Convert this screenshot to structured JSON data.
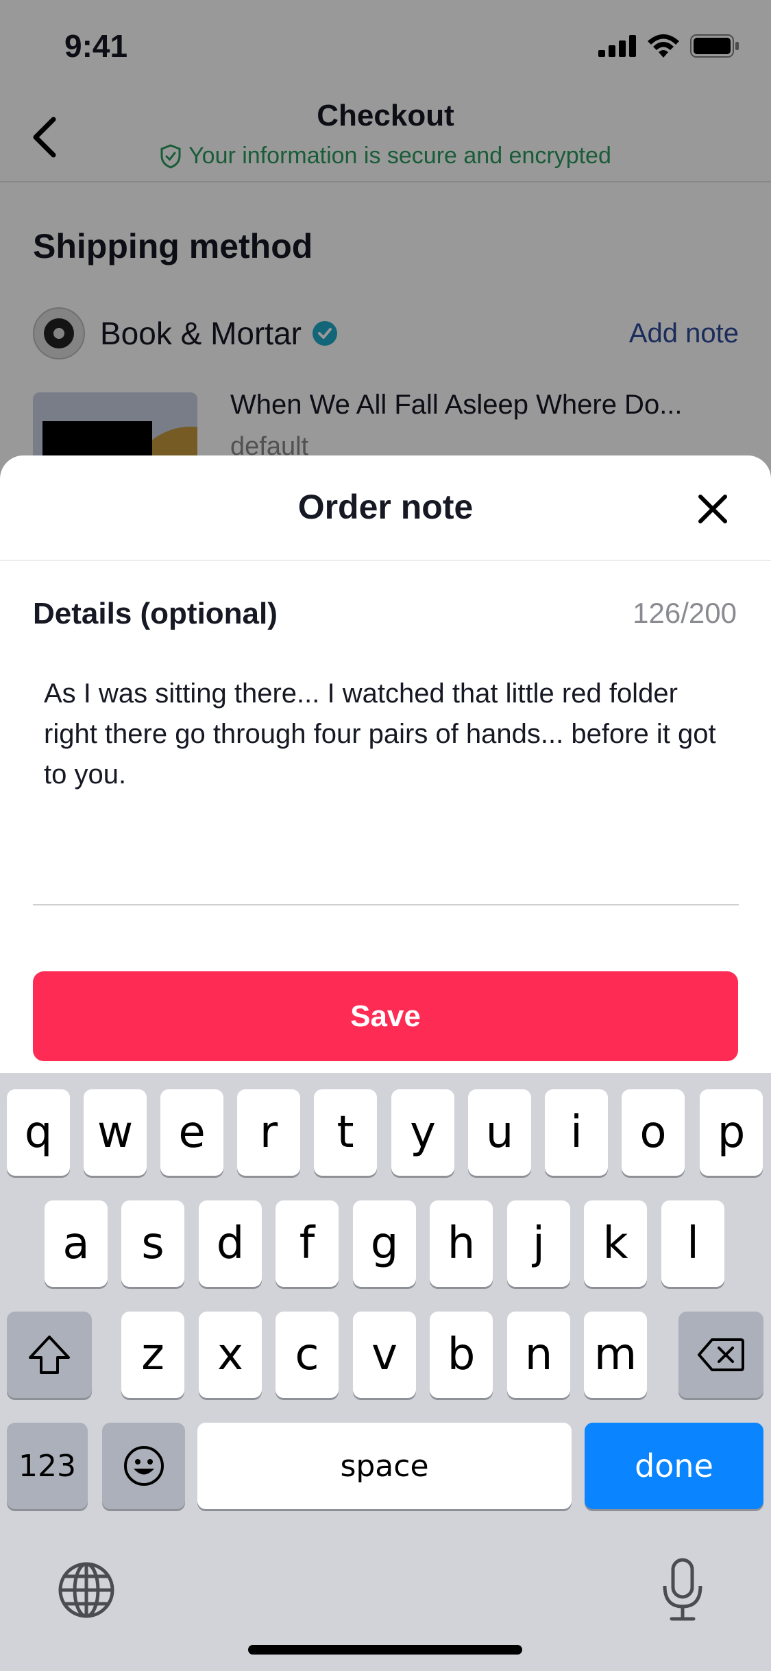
{
  "status_bar": {
    "time": "9:41"
  },
  "nav": {
    "title": "Checkout",
    "secure_text": "Your information is secure and encrypted"
  },
  "shipping": {
    "section_title": "Shipping method",
    "seller_name": "Book & Mortar",
    "add_note": "Add note",
    "product_title": "When We All Fall Asleep Where Do...",
    "product_variant": "default"
  },
  "sheet": {
    "title": "Order note",
    "details_label": "Details (optional)",
    "counter": "126/200",
    "note_text": "As I was sitting there... I watched that little red folder right there go through four pairs of hands... before it got to you.",
    "save_label": "Save"
  },
  "keyboard": {
    "row1": [
      "q",
      "w",
      "e",
      "r",
      "t",
      "y",
      "u",
      "i",
      "o",
      "p"
    ],
    "row2": [
      "a",
      "s",
      "d",
      "f",
      "g",
      "h",
      "j",
      "k",
      "l"
    ],
    "row3": [
      "z",
      "x",
      "c",
      "v",
      "b",
      "n",
      "m"
    ],
    "numbers_label": "123",
    "space_label": "space",
    "done_label": "done"
  },
  "icons": {
    "back": "chevron-left-icon",
    "secure": "shield-check-icon",
    "verified": "verified-badge-icon",
    "close": "close-icon",
    "shift": "shift-icon",
    "backspace": "backspace-icon",
    "emoji": "emoji-icon",
    "globe": "globe-icon",
    "mic": "microphone-icon"
  },
  "colors": {
    "accent": "#fe2c55",
    "secure_green": "#2b9a5e",
    "link_blue": "#2d4a9a",
    "keyboard_done": "#0a84ff"
  }
}
